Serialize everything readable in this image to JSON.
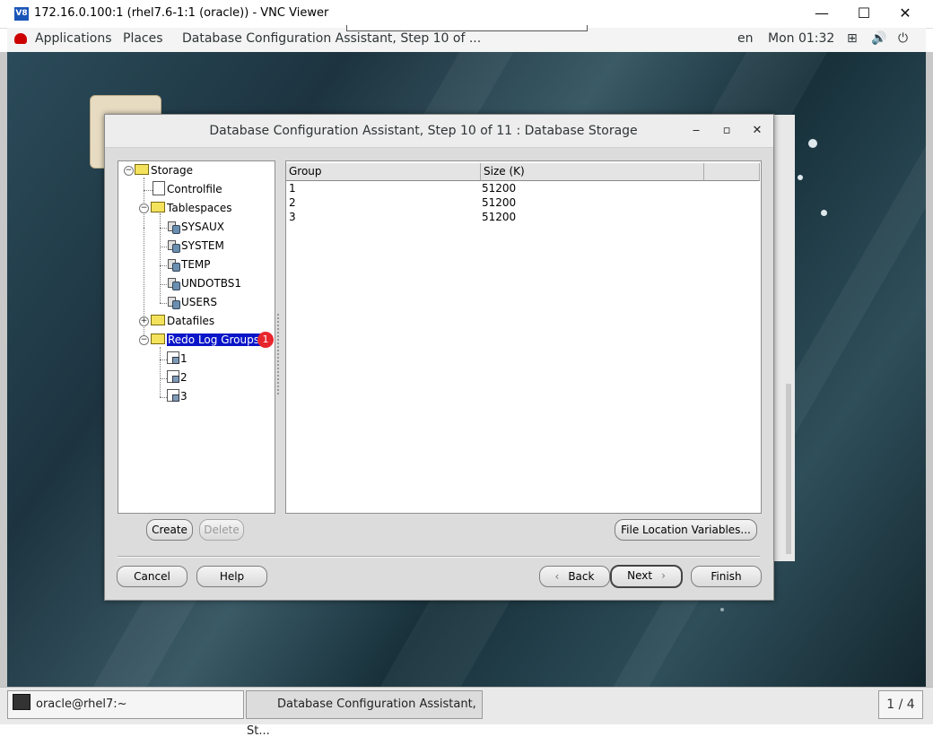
{
  "vnc": {
    "title": "172.16.0.100:1 (rhel7.6-1:1 (oracle)) - VNC Viewer",
    "logo": "V8",
    "minimize": "—",
    "maximize": "☐",
    "close": "✕"
  },
  "topbar": {
    "applications": "Applications",
    "places": "Places",
    "active_window": "Database Configuration Assistant, Step 10 of ...",
    "language": "en",
    "clock": "Mon 01:32",
    "network_icon": "⊞",
    "volume_icon": "🔊",
    "power_icon": "⏻"
  },
  "dialog": {
    "title": "Database Configuration Assistant, Step 10 of 11 : Database Storage",
    "minimize": "‒",
    "maximize": "▫",
    "close": "✕",
    "tree": {
      "root": "Storage",
      "controlfile": "Controlfile",
      "tablespaces": "Tablespaces",
      "tablespace_items": [
        "SYSAUX",
        "SYSTEM",
        "TEMP",
        "UNDOTBS1",
        "USERS"
      ],
      "datafiles": "Datafiles",
      "redo_log_groups": "Redo Log Groups",
      "redo_items": [
        "1",
        "2",
        "3"
      ],
      "badge": "1"
    },
    "table": {
      "columns": [
        "Group",
        "Size (K)"
      ],
      "rows": [
        [
          "1",
          "51200"
        ],
        [
          "2",
          "51200"
        ],
        [
          "3",
          "51200"
        ]
      ]
    },
    "buttons": {
      "create": "Create",
      "delete": "Delete",
      "file_location_variables": "File Location Variables...",
      "cancel": "Cancel",
      "help": "Help",
      "back": "Back",
      "next": "Next",
      "finish": "Finish"
    }
  },
  "taskbar": {
    "terminal": "oracle@rhel7:~",
    "dbca": "Database Configuration Assistant, St...",
    "pager": "1 / 4"
  }
}
